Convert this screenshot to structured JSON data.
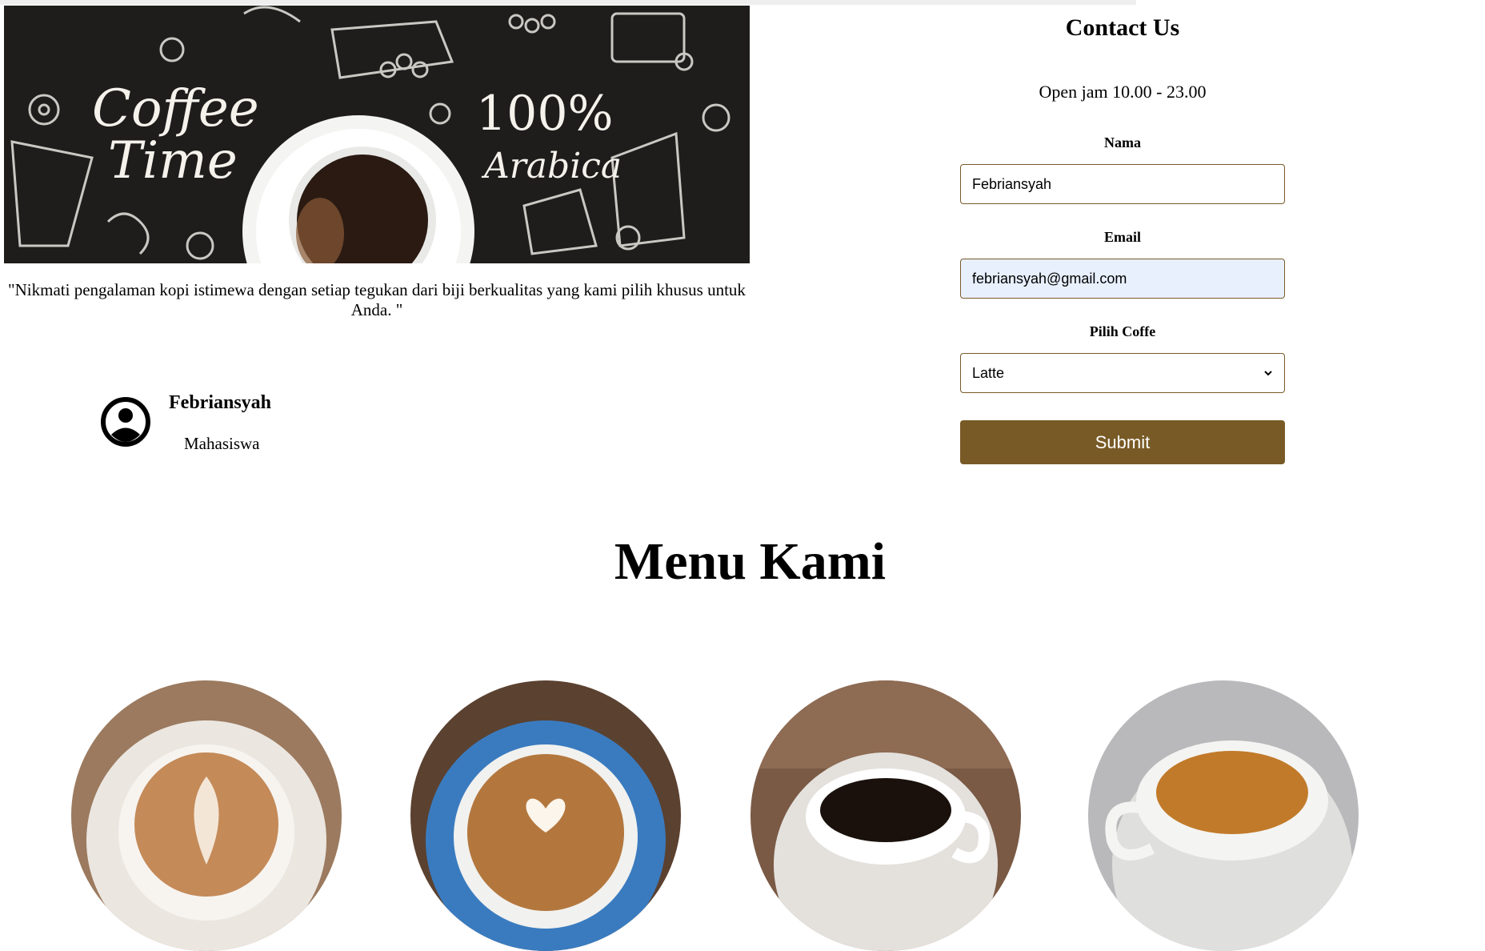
{
  "hero": {
    "banner_text_1": "Coffee",
    "banner_text_2": "Time",
    "banner_text_3": "100%",
    "banner_text_4": "Arabica",
    "quote": "\"Nikmati pengalaman kopi istimewa dengan setiap tegukan dari biji berkualitas yang kami pilih khusus untuk Anda. \""
  },
  "profile": {
    "icon": "account-circle-icon",
    "name": "Febriansyah",
    "role": "Mahasiswa"
  },
  "contact": {
    "title": "Contact Us",
    "hours": "Open jam 10.00 - 23.00",
    "name_label": "Nama",
    "name_value": "Febriansyah",
    "email_label": "Email",
    "email_value": "febriansyah@gmail.com",
    "coffee_label": "Pilih Coffe",
    "coffee_selected": "Latte",
    "submit_label": "Submit",
    "accent_color": "#785a26"
  },
  "menu": {
    "title": "Menu Kami",
    "items": [
      {
        "image": "latte-art-cup-photo"
      },
      {
        "image": "cappuccino-blue-cup-photo"
      },
      {
        "image": "black-coffee-cup-photo"
      },
      {
        "image": "espresso-cup-photo"
      }
    ]
  }
}
